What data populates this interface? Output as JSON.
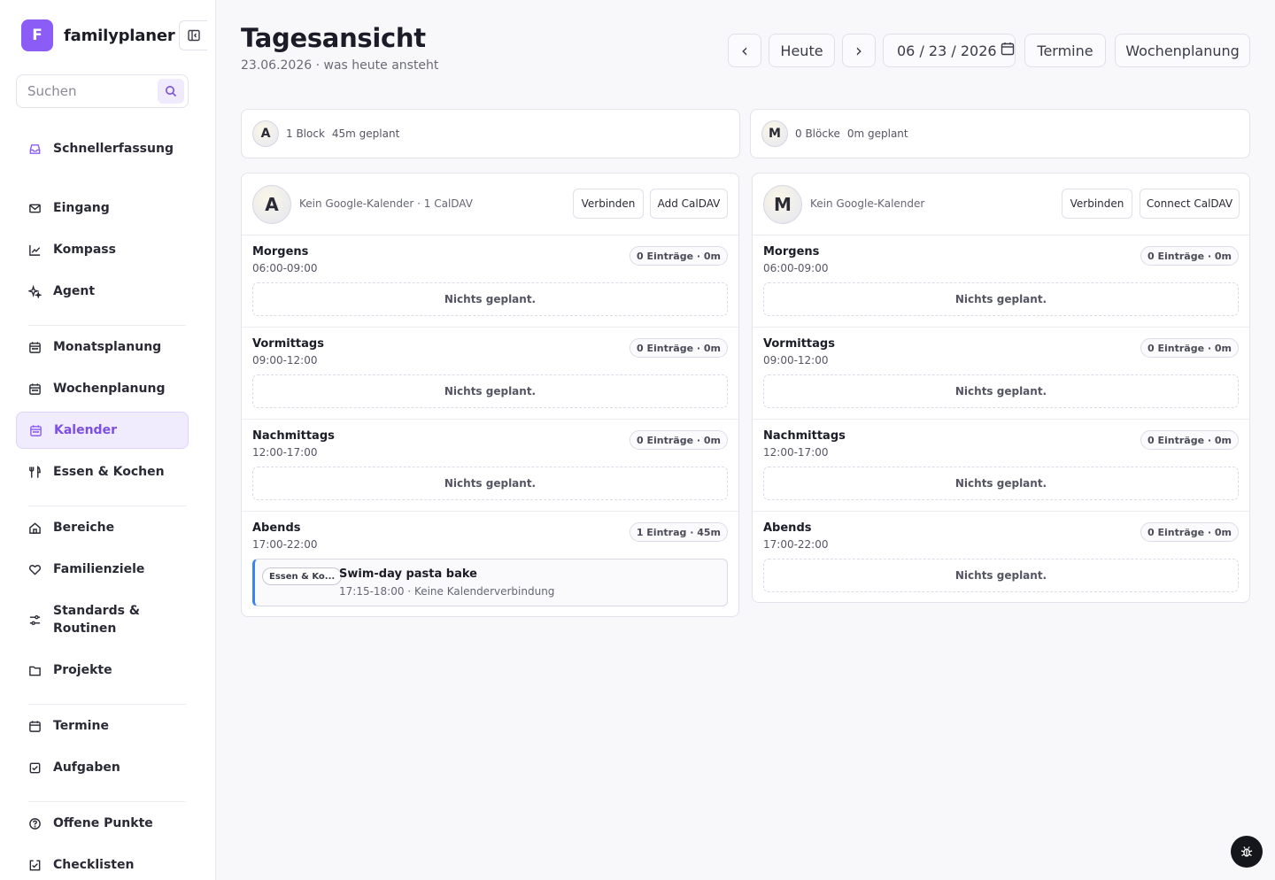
{
  "brand": {
    "logo_letter": "F",
    "name": "familyplaner"
  },
  "search": {
    "placeholder": "Suchen"
  },
  "nav": {
    "quick_capture": "Schnellerfassung",
    "inbox": "Eingang",
    "compass": "Kompass",
    "agent": "Agent",
    "monthly": "Monatsplanung",
    "weekly": "Wochenplanung",
    "calendar": "Kalender",
    "food": "Essen & Kochen",
    "areas": "Bereiche",
    "family_goals": "Familienziele",
    "standards": "Standards & Routinen",
    "projects": "Projekte",
    "appointments": "Termine",
    "tasks": "Aufgaben",
    "open_points": "Offene Punkte",
    "checklists": "Checklisten"
  },
  "header": {
    "title": "Tagesansicht",
    "subtitle": "23.06.2026 · was heute ansteht",
    "prev": "‹",
    "today": "Heute",
    "next": "›",
    "date_value": "06 / 23 / 2026",
    "appointments_btn": "Termine",
    "weekly_btn": "Wochenplanung"
  },
  "summaries": [
    {
      "initial": "A",
      "blocks": "1 Block",
      "planned": "45m geplant"
    },
    {
      "initial": "M",
      "blocks": "0 Blöcke",
      "planned": "0m geplant"
    }
  ],
  "columns": [
    {
      "initial": "A",
      "calendar_text": "Kein Google-Kalender · 1 CalDAV",
      "connect_btn": "Verbinden",
      "caldav_btn": "Add CalDAV",
      "slots": [
        {
          "name": "Morgens",
          "time": "06:00-09:00",
          "badge": "0 Einträge · 0m",
          "empty": "Nichts geplant."
        },
        {
          "name": "Vormittags",
          "time": "09:00-12:00",
          "badge": "0 Einträge · 0m",
          "empty": "Nichts geplant."
        },
        {
          "name": "Nachmittags",
          "time": "12:00-17:00",
          "badge": "0 Einträge · 0m",
          "empty": "Nichts geplant."
        },
        {
          "name": "Abends",
          "time": "17:00-22:00",
          "badge": "1 Eintrag · 45m",
          "event": {
            "tag": "Essen & Ko...",
            "title": "Swim-day pasta bake",
            "meta": "17:15-18:00 · Keine Kalenderverbindung"
          }
        }
      ]
    },
    {
      "initial": "M",
      "calendar_text": "Kein Google-Kalender",
      "connect_btn": "Verbinden",
      "caldav_btn": "Connect CalDAV",
      "slots": [
        {
          "name": "Morgens",
          "time": "06:00-09:00",
          "badge": "0 Einträge · 0m",
          "empty": "Nichts geplant."
        },
        {
          "name": "Vormittags",
          "time": "09:00-12:00",
          "badge": "0 Einträge · 0m",
          "empty": "Nichts geplant."
        },
        {
          "name": "Nachmittags",
          "time": "12:00-17:00",
          "badge": "0 Einträge · 0m",
          "empty": "Nichts geplant."
        },
        {
          "name": "Abends",
          "time": "17:00-22:00",
          "badge": "0 Einträge · 0m",
          "empty": "Nichts geplant."
        }
      ]
    }
  ],
  "colors": {
    "accent": "#8b5cf6",
    "active_text": "#7c4ee4",
    "event_border": "#3b82f6"
  }
}
